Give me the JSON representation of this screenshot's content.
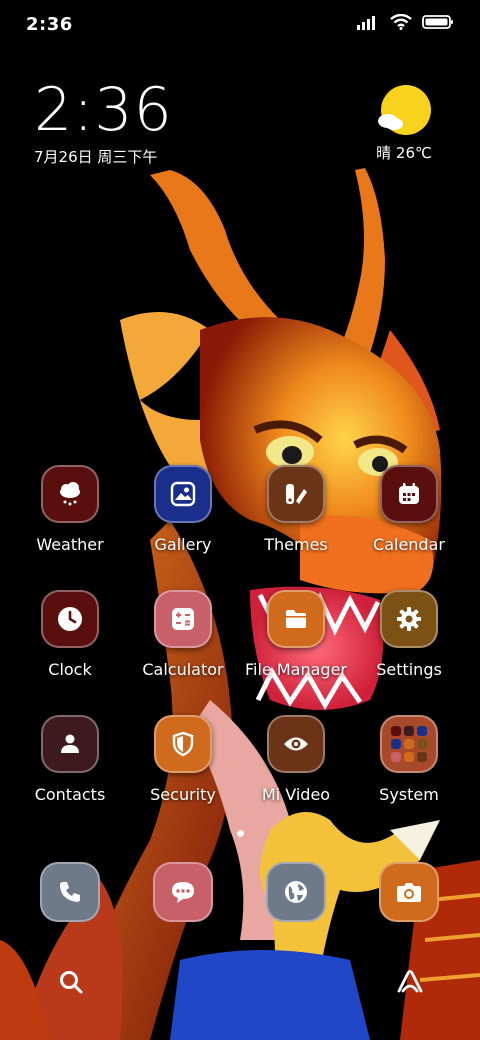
{
  "status_bar": {
    "time": "2:36",
    "icons": [
      "signal-icon",
      "wifi-icon",
      "battery-icon"
    ]
  },
  "clock_widget": {
    "time": "2:36",
    "date": "7月26日 周三下午"
  },
  "weather_widget": {
    "condition_icon": "sunny-cloud-icon",
    "text": "晴 26℃"
  },
  "apps": [
    {
      "label": "Weather",
      "icon": "weather-icon",
      "color": "#5a0f0f"
    },
    {
      "label": "Gallery",
      "icon": "gallery-icon",
      "color": "#1a2e8c"
    },
    {
      "label": "Themes",
      "icon": "themes-icon",
      "color": "#6b3417"
    },
    {
      "label": "Calendar",
      "icon": "calendar-icon",
      "color": "#5a0e0e"
    },
    {
      "label": "Clock",
      "icon": "clock-icon",
      "color": "#5a0f0f"
    },
    {
      "label": "Calculator",
      "icon": "calculator-icon",
      "color": "#c8606a"
    },
    {
      "label": "File Manager",
      "icon": "folder-icon",
      "color": "#d06a1c"
    },
    {
      "label": "Settings",
      "icon": "gear-icon",
      "color": "#7d5114"
    },
    {
      "label": "Contacts",
      "icon": "contacts-icon",
      "color": "#3d1a1d"
    },
    {
      "label": "Security",
      "icon": "shield-icon",
      "color": "#d06a1c"
    },
    {
      "label": "Mi Video",
      "icon": "eye-icon",
      "color": "#6b3417"
    },
    {
      "label": "System",
      "icon": "folder-grid-icon",
      "color": "#a84a2a"
    }
  ],
  "page_indicator": {
    "pages": 2,
    "active": 1
  },
  "dock": [
    {
      "name": "phone",
      "icon": "phone-icon",
      "color": "#6e7a8a"
    },
    {
      "name": "messages",
      "icon": "message-icon",
      "color": "#c8606a"
    },
    {
      "name": "browser",
      "icon": "globe-icon",
      "color": "#6e7a8a"
    },
    {
      "name": "camera",
      "icon": "camera-icon",
      "color": "#d06a1c"
    }
  ],
  "bottom_bar": {
    "left_icon": "search-icon",
    "right_icon": "assistant-icon"
  }
}
